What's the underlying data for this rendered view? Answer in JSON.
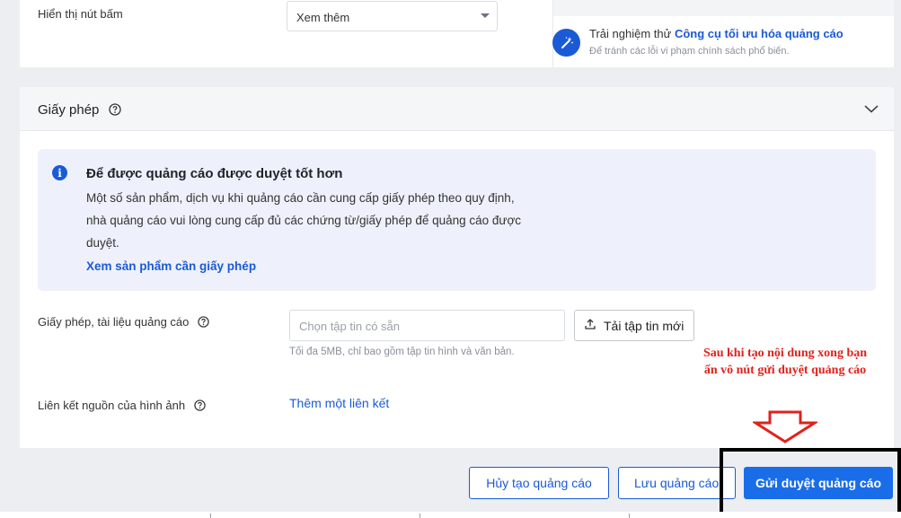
{
  "top": {
    "button_display_label": "Hiển thị nút bấm",
    "button_display_value": "Xem thêm",
    "tip_prefix": "Trải nghiệm thử",
    "tip_link": "Công cụ tối ưu hóa quảng cáo",
    "tip_sub": "Để tránh các lỗi vi phạm chính sách phổ biến."
  },
  "license": {
    "section_title": "Giấy phép",
    "info_title": "Để được quảng cáo được duyệt tốt hơn",
    "info_text": "Một số sản phẩm, dịch vụ khi quảng cáo cần cung cấp giấy phép theo quy định, nhà quảng cáo vui lòng cung cấp đủ các chứng từ/giấy phép để quảng cáo được duyệt.",
    "info_link": "Xem sản phẩm cần giấy phép",
    "docs_label": "Giấy phép, tài liệu quảng cáo",
    "docs_placeholder": "Chọn tập tin có sẵn",
    "upload_label": "Tải tập tin mới",
    "docs_hint": "Tối đa 5MB, chỉ bao gồm tập tin hình và văn bản.",
    "source_label": "Liên kết nguồn của hình ảnh",
    "add_link": "Thêm một liên kết"
  },
  "annotation": {
    "line1": "Sau khi tạo nội dung xong bạn",
    "line2": "ấn vô nút gửi duyệt quảng cáo"
  },
  "footer": {
    "cancel": "Hủy tạo quảng cáo",
    "save": "Lưu quảng cáo",
    "submit": "Gửi duyệt quảng cáo"
  },
  "colors": {
    "accent": "#1a5ad6",
    "primary_button": "#1a6de8",
    "annotation": "#e0221c",
    "info_bg": "#eef1fb"
  }
}
